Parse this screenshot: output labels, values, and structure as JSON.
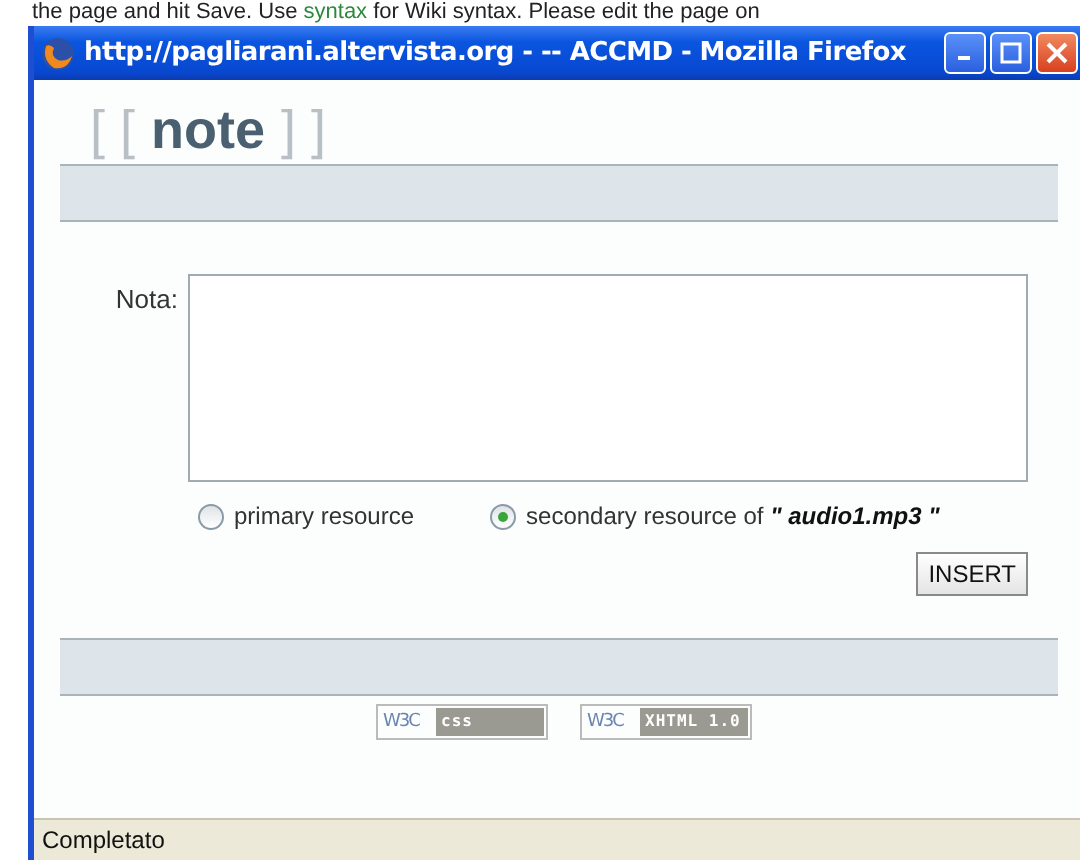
{
  "background_page": {
    "text_before": "the page and hit Save. Use ",
    "link": "syntax",
    "text_after": " for Wiki syntax. Please edit the page on"
  },
  "window": {
    "title": "http://pagliarani.altervista.org - -- ACCMD - Mozilla Firefox"
  },
  "logo": {
    "open": "[ [",
    "word": "note",
    "close": "] ]"
  },
  "form": {
    "label": "Nota:",
    "options": [
      {
        "label": "primary resource",
        "selected": false
      },
      {
        "label": "secondary resource of **\" audio1.mp3 \"**",
        "selected": true
      }
    ],
    "button": "INSERT"
  },
  "badges": [
    {
      "mark": "W3C",
      "label": "css"
    },
    {
      "mark": "W3C",
      "label": "XHTML 1.0"
    }
  ],
  "status_bar": "Completato"
}
